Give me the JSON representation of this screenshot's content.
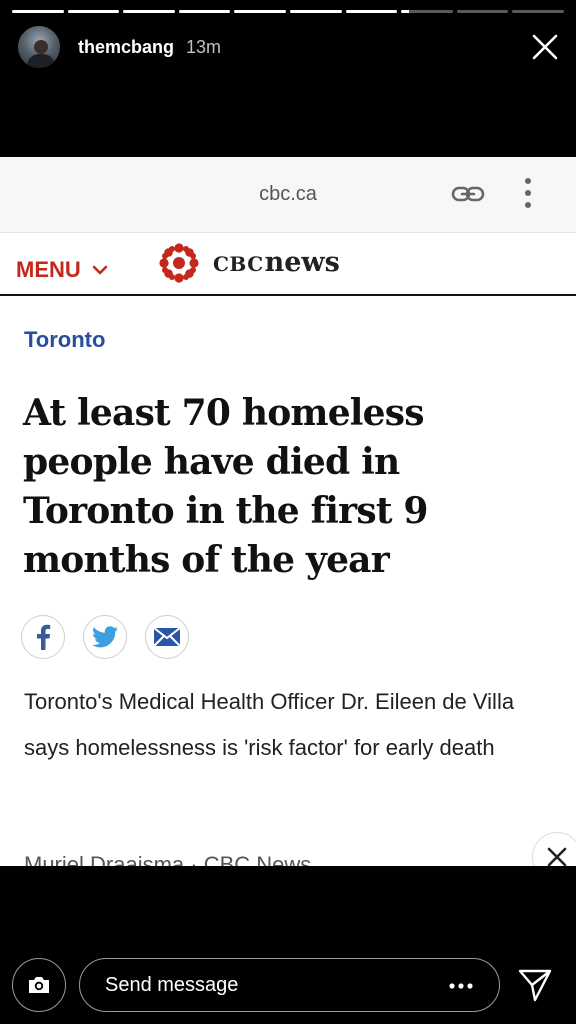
{
  "story": {
    "progress": {
      "segments": 10,
      "active_index": 7,
      "active_fraction": 0.15
    },
    "username": "themcbang",
    "time_ago": "13m",
    "icons": {
      "close": "close-icon"
    }
  },
  "browser": {
    "url": "cbc.ca",
    "icons": {
      "link": "link-icon",
      "more": "more-vertical-icon"
    }
  },
  "cbc": {
    "menu_label": "MENU",
    "brand_small": "CBC",
    "brand_big": "news",
    "brand_color": "#c4271c"
  },
  "article": {
    "section": "Toronto",
    "section_color": "#2a4e9e",
    "headline": "At least 70 homeless people have died in Toronto in the first 9 months of the year",
    "share_icons": [
      "facebook-icon",
      "twitter-icon",
      "email-icon"
    ],
    "summary": "Toronto's Medical Health Officer Dr. Eileen de Villa says homelessness is 'risk factor' for early death",
    "byline": "Muriel Draaisma · CBC News"
  },
  "footer": {
    "message_placeholder": "Send message",
    "icons": {
      "camera": "camera-icon",
      "more": "more-horizontal-icon",
      "send": "send-icon"
    }
  }
}
